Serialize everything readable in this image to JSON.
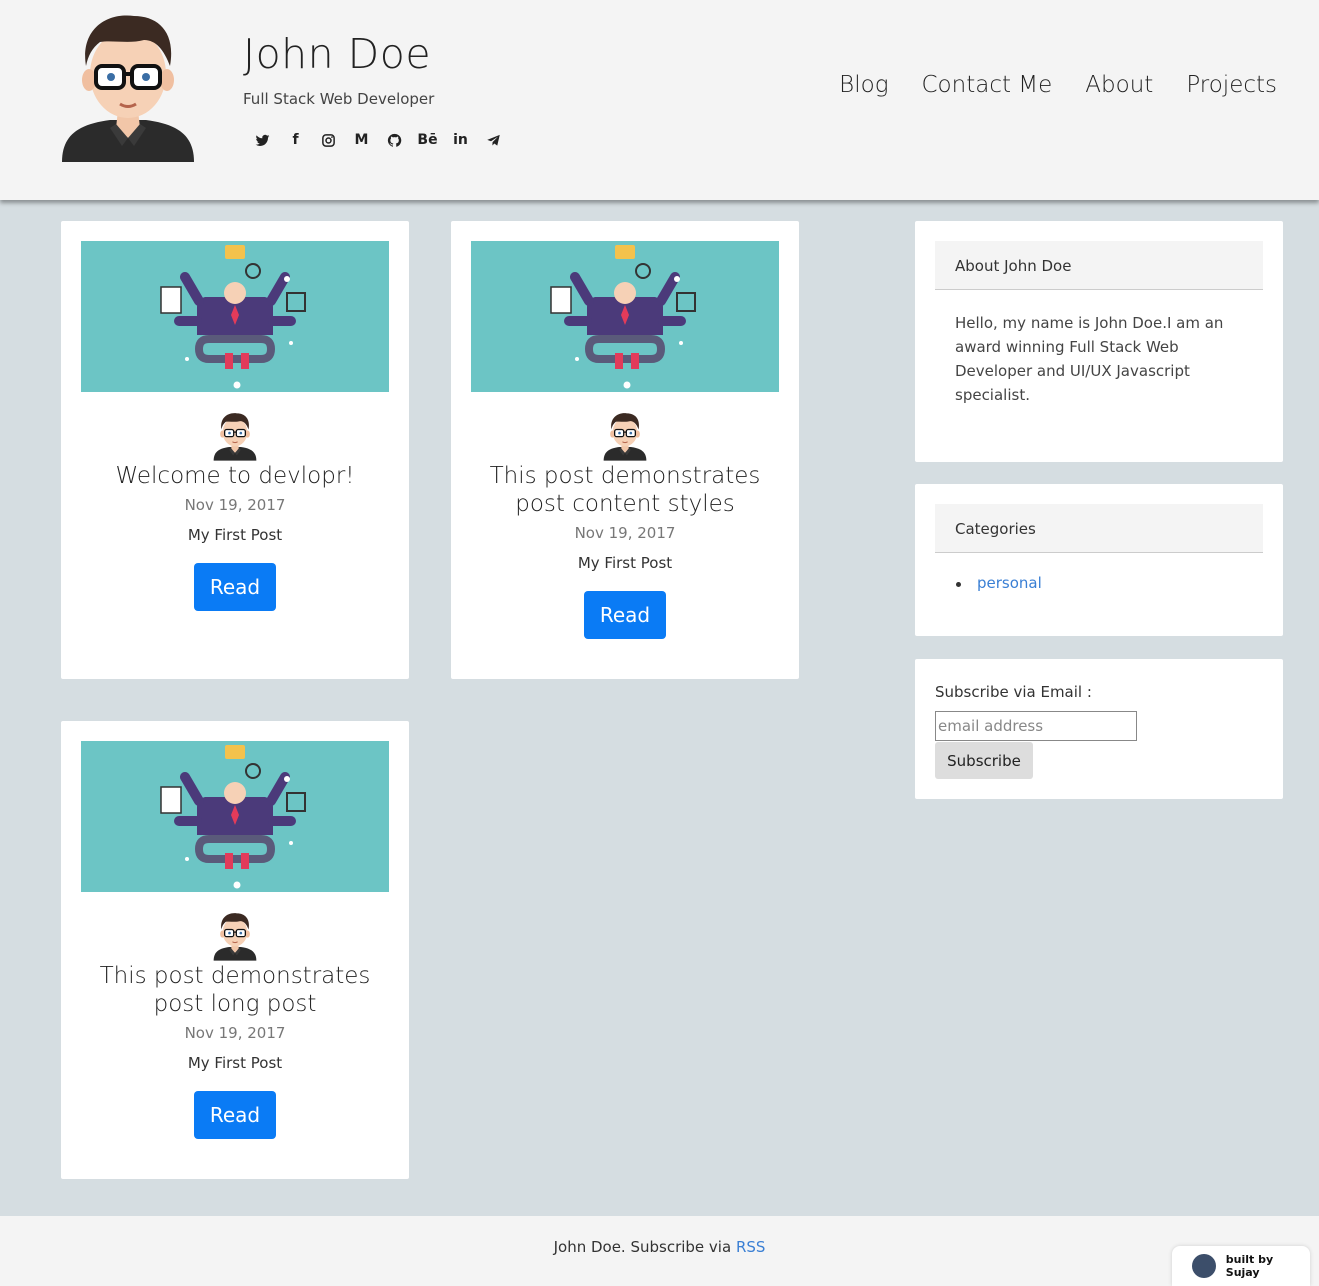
{
  "header": {
    "title": "John Doe",
    "subtitle": "Full Stack Web Developer",
    "social": [
      {
        "icon": "twitter-icon",
        "glyph": "🐦"
      },
      {
        "icon": "facebook-icon",
        "glyph": "f"
      },
      {
        "icon": "instagram-icon",
        "glyph": "◎"
      },
      {
        "icon": "medium-icon",
        "glyph": "M"
      },
      {
        "icon": "github-icon",
        "glyph": "●"
      },
      {
        "icon": "behance-icon",
        "glyph": "Bē"
      },
      {
        "icon": "linkedin-icon",
        "glyph": "in"
      },
      {
        "icon": "telegram-icon",
        "glyph": "➤"
      }
    ],
    "nav": [
      "Blog",
      "Contact Me",
      "About",
      "Projects"
    ]
  },
  "posts": [
    {
      "title": "Welcome to devlopr!",
      "date": "Nov 19, 2017",
      "excerpt": "My First Post",
      "button": "Read"
    },
    {
      "title": "This post demonstrates post content styles",
      "date": "Nov 19, 2017",
      "excerpt": "My First Post",
      "button": "Read"
    },
    {
      "title": "This post demonstrates post long post",
      "date": "Nov 19, 2017",
      "excerpt": "My First Post",
      "button": "Read"
    }
  ],
  "sidebar": {
    "about_title": "About John Doe",
    "about_text": "Hello, my name is John Doe.I am an award winning Full Stack Web Developer and UI/UX Javascript specialist.",
    "categories_title": "Categories",
    "categories": [
      "personal"
    ],
    "subscribe_label": "Subscribe via Email :",
    "email_placeholder": "email address",
    "subscribe_button": "Subscribe"
  },
  "footer": {
    "text": "John Doe. Subscribe via ",
    "rss": "RSS",
    "badge": "built by Sujay"
  },
  "colors": {
    "accent": "#0a7bf5",
    "link": "#3a7fd4",
    "background": "#d5dde1",
    "header": "#f4f4f4",
    "illustration": "#6cc5c5"
  }
}
